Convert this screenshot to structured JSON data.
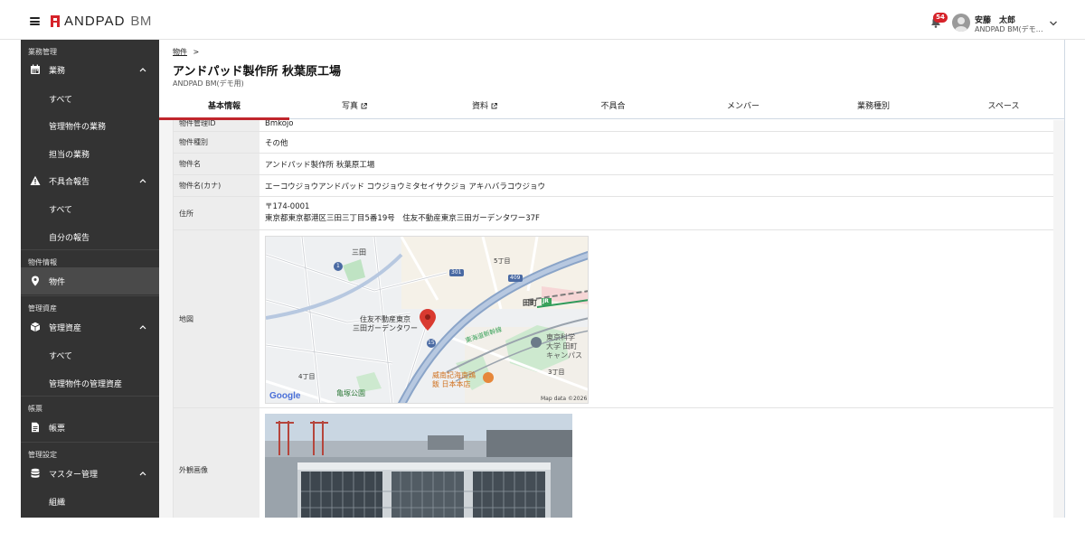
{
  "header": {
    "logo_text": "ANDPAD",
    "logo_suffix": "BM",
    "notification_count": "54",
    "user_name": "安藤　太郎",
    "user_org": "ANDPAD BM(デモ…"
  },
  "sidebar": {
    "sections": [
      {
        "label": "業務管理"
      },
      {
        "label": "物件情報"
      },
      {
        "label": "管理資産"
      },
      {
        "label": "帳票"
      },
      {
        "label": "管理設定"
      }
    ],
    "items": {
      "gyomu": "業務",
      "gyomu_all": "すべて",
      "gyomu_managed": "管理物件の業務",
      "gyomu_mine": "担当の業務",
      "defect": "不具合報告",
      "defect_all": "すべて",
      "defect_mine": "自分の報告",
      "property": "物件",
      "asset": "管理資産",
      "asset_all": "すべて",
      "asset_managed": "管理物件の管理資産",
      "forms": "帳票",
      "master": "マスター管理",
      "org": "組織"
    }
  },
  "breadcrumb": {
    "link": "物件",
    "separator": ">"
  },
  "page": {
    "title": "アンドパッド製作所 秋葉原工場",
    "subtitle": "ANDPAD BM(デモ用)"
  },
  "tabs": [
    {
      "label": "基本情報",
      "active": true
    },
    {
      "label": "写真",
      "external": true
    },
    {
      "label": "資料",
      "external": true
    },
    {
      "label": "不具合"
    },
    {
      "label": "メンバー"
    },
    {
      "label": "業務種別"
    },
    {
      "label": "スペース"
    }
  ],
  "details": {
    "id_label": "物件管理ID",
    "id_value": "Bmkojo",
    "type_label": "物件種別",
    "type_value": "その他",
    "name_label": "物件名",
    "name_value": "アンドパッド製作所 秋葉原工場",
    "kana_label": "物件名(カナ)",
    "kana_value": "エーコウジョウアンドパッド コウジョウミタセイサクジョ アキハバラコウジョウ",
    "address_label": "住所",
    "address_zip": "〒174-0001",
    "address_line": "東京都東京都港区三田三丁目5番19号　住友不動産東京三田ガーデンタワー37F",
    "map_label": "地図",
    "photo_label": "外観画像"
  },
  "map": {
    "pin_label_1": "住友不動産東京",
    "pin_label_2": "三田ガーデンタワー",
    "place_mita": "三田",
    "place_5chome": "5丁目",
    "place_tamachi": "田町",
    "place_jr": "JR",
    "place_shinkansen": "東海道新幹線",
    "place_univ_1": "東京科学",
    "place_univ_2": "大学 田町",
    "place_univ_3": "キャンパス",
    "place_3chome": "3丁目",
    "place_4chome": "4丁目",
    "place_park": "亀塚公園",
    "place_rest_1": "威南記海南鶏",
    "place_rest_2": "飯 日本本店",
    "route_301": "301",
    "route_409": "409",
    "route_15": "15",
    "route_1": "1",
    "google": "Google",
    "copyright": "Map data ©2026"
  },
  "colors": {
    "accent": "#c0262c",
    "sidebar_bg": "#333333",
    "badge": "#d6232a"
  }
}
